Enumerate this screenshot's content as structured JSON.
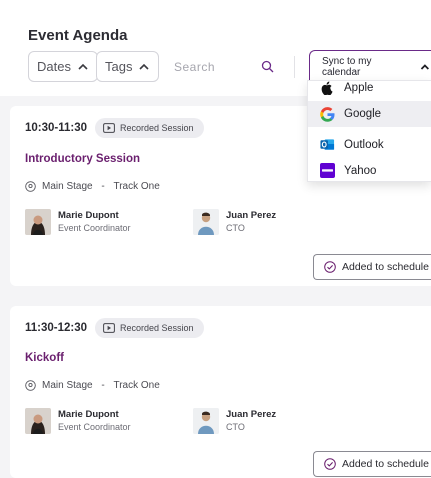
{
  "header": {
    "title": "Event Agenda",
    "filters": [
      {
        "label": "Dates"
      },
      {
        "label": "Tags"
      }
    ],
    "search": {
      "placeholder": "Search",
      "value": ""
    },
    "sync": {
      "label": "Sync to my calendar"
    }
  },
  "calendar_menu": {
    "items": [
      {
        "label": "Apple",
        "icon": "apple-icon"
      },
      {
        "label": "Google",
        "icon": "google-icon"
      },
      {
        "label": "Outlook",
        "icon": "outlook-icon"
      },
      {
        "label": "Yahoo",
        "icon": "yahoo-icon"
      }
    ],
    "hovered": "Google"
  },
  "sessions": [
    {
      "time": "10:30-11:30",
      "badge": "Recorded Session",
      "title": "Introductory Session",
      "location": "Main Stage",
      "track": "Track One",
      "location_sep": " - ",
      "speakers": [
        {
          "name": "Marie Dupont",
          "role": "Event Coordinator"
        },
        {
          "name": "Juan Perez",
          "role": "CTO"
        }
      ],
      "action": "Added to schedule"
    },
    {
      "time": "11:30-12:30",
      "badge": "Recorded Session",
      "title": "Kickoff",
      "location": "Main Stage",
      "track": "Track One",
      "location_sep": " - ",
      "speakers": [
        {
          "name": "Marie Dupont",
          "role": "Event Coordinator"
        },
        {
          "name": "Juan Perez",
          "role": "CTO"
        }
      ],
      "action": "Added to schedule"
    }
  ],
  "colors": {
    "accent": "#6a1f6e",
    "sync_border": "#6a2a88"
  }
}
